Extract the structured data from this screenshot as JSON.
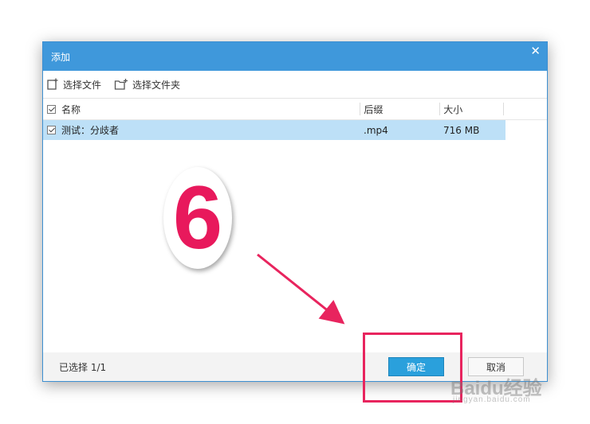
{
  "dialog": {
    "title": "添加",
    "close_glyph": "✕"
  },
  "toolbar": {
    "select_file": "选择文件",
    "select_folder": "选择文件夹"
  },
  "table": {
    "headers": {
      "name": "名称",
      "suffix": "后缀",
      "size": "大小"
    },
    "rows": [
      {
        "name": "测试：分歧者",
        "suffix": ".mp4",
        "size": "716 MB",
        "checked": true
      }
    ]
  },
  "footer": {
    "selected_count": "已选择 1/1",
    "ok_label": "确定",
    "cancel_label": "取消"
  },
  "annotation": {
    "step_number": "6",
    "accent_color": "#e8245e"
  },
  "watermark": {
    "brand": "Baidu经验",
    "url": "jingyan.baidu.com"
  },
  "icons": {
    "select_file": "add-file-icon",
    "select_folder": "add-folder-icon",
    "close": "close-icon"
  },
  "colors": {
    "titlebar": "#3f98db",
    "selected_row": "#bde0f7",
    "ok_button": "#2aa0dc"
  }
}
